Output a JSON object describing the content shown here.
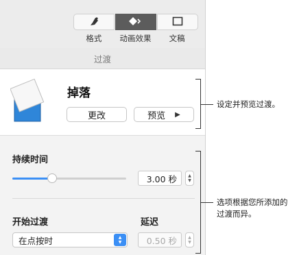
{
  "toolbar": {
    "tabs": [
      {
        "label": "格式",
        "icon": "paintbrush-icon",
        "active": false
      },
      {
        "label": "动画效果",
        "icon": "diamond-animate-icon",
        "active": true
      },
      {
        "label": "文稿",
        "icon": "document-frame-icon",
        "active": false
      }
    ]
  },
  "section": {
    "title": "过渡"
  },
  "transition": {
    "effect_name": "掉落",
    "change_label": "更改",
    "preview_label": "预览",
    "preview_glyph": "▶"
  },
  "duration": {
    "label": "持续时间",
    "value": "3.00 秒",
    "slider_fraction": 0.35
  },
  "start": {
    "label": "开始过渡",
    "option": "在点按时"
  },
  "delay": {
    "label": "延迟",
    "value": "0.50 秒"
  },
  "callouts": {
    "preview": "设定并预览过渡。",
    "options_line1": "选项根据您所添加的",
    "options_line2": "过渡而异。"
  },
  "colors": {
    "accent": "#3b8ff5",
    "active_tab": "#5c5c5c",
    "thumb_blue": "#2f86d9"
  }
}
